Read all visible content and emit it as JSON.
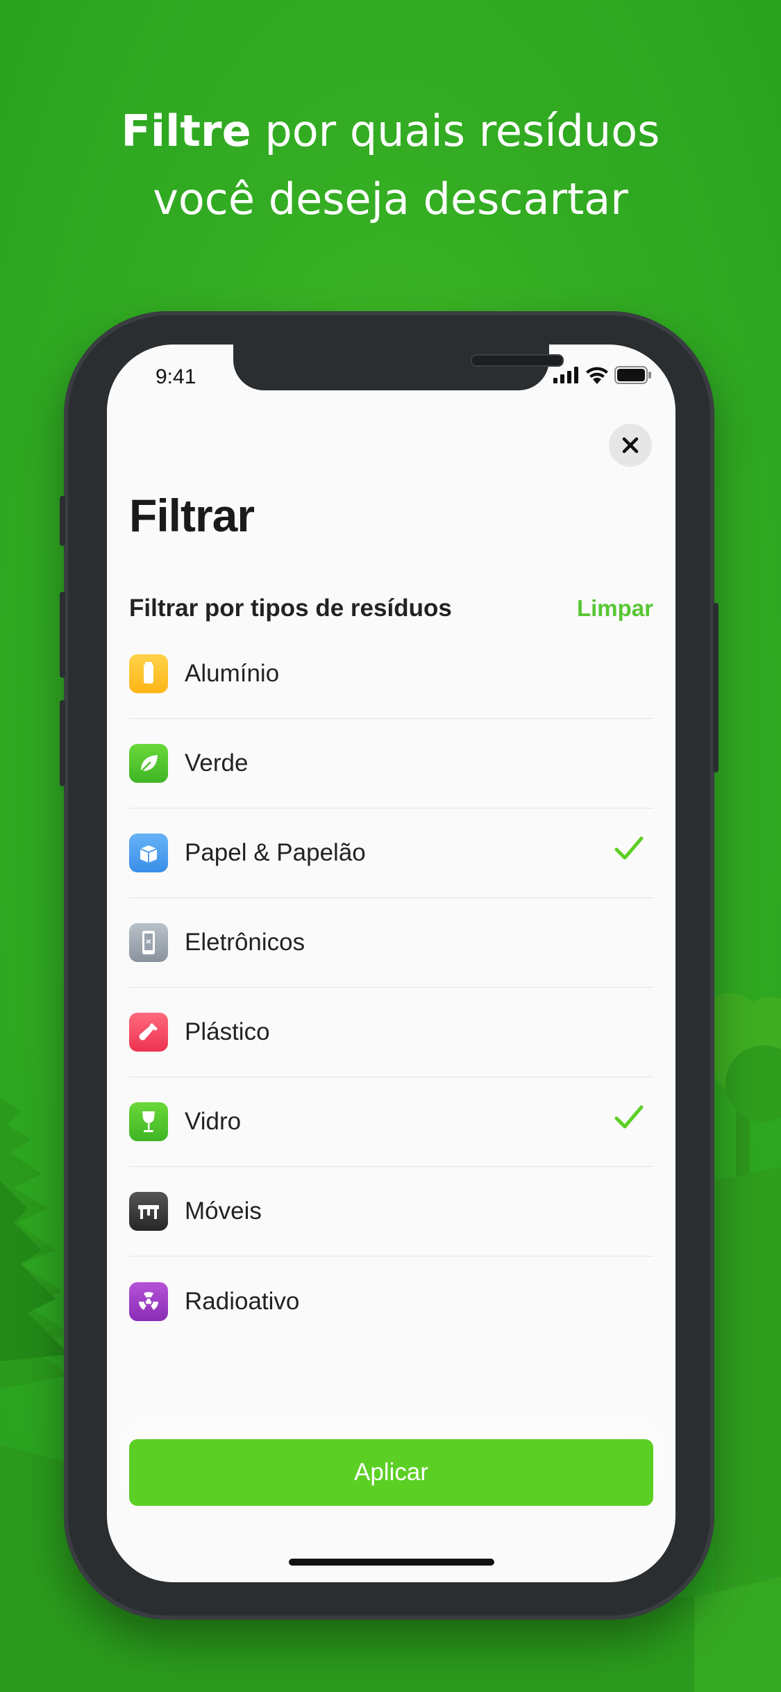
{
  "headline": {
    "bold": "Filtre",
    "line1_rest": " por quais resíduos",
    "line2": "você deseja descartar"
  },
  "status_bar": {
    "time": "9:41"
  },
  "screen": {
    "title": "Filtrar",
    "section_title": "Filtrar por tipos de resíduos",
    "clear_label": "Limpar",
    "apply_label": "Aplicar"
  },
  "categories": [
    {
      "label": "Alumínio",
      "icon": "can-icon",
      "color": "#ffc02e",
      "checked": false
    },
    {
      "label": "Verde",
      "icon": "leaf-icon",
      "color": "#5ccf24",
      "checked": false
    },
    {
      "label": "Papel & Papelão",
      "icon": "box-icon",
      "color": "#3f9bf0",
      "checked": true
    },
    {
      "label": "Eletrônicos",
      "icon": "phone-icon",
      "color": "#9aa3ad",
      "checked": false
    },
    {
      "label": "Plástico",
      "icon": "bottle-icon",
      "color": "#f2455e",
      "checked": false
    },
    {
      "label": "Vidro",
      "icon": "wine-glass-icon",
      "color": "#5ccf24",
      "checked": true
    },
    {
      "label": "Móveis",
      "icon": "table-icon",
      "color": "#3a3a3a",
      "checked": false
    },
    {
      "label": "Radioativo",
      "icon": "radiation-icon",
      "color": "#a03cc8",
      "checked": false
    }
  ],
  "colors": {
    "accent": "#58c634",
    "background": "#34ad23",
    "check": "#5ccf24"
  }
}
